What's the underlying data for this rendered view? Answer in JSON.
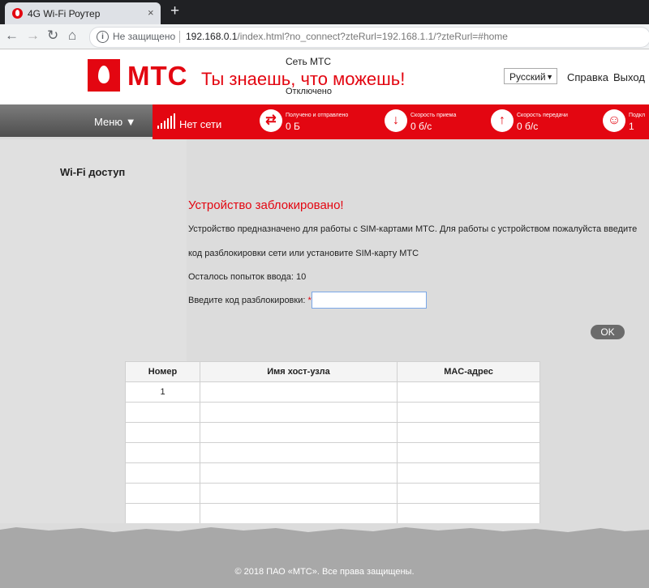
{
  "browser": {
    "tab_title": "4G Wi-Fi Роутер",
    "tab_close": "×",
    "new_tab": "+",
    "security": "Не защищено",
    "url_host": "192.168.0.1",
    "url_path": "/index.html?no_connect?zteRurl=192.168.1.1/?zteRurl=#home"
  },
  "header": {
    "brand": "МТС",
    "slogan": "Ты знаешь, что можешь!",
    "network_label": "Сеть МТС",
    "network_state": "Отключено",
    "language": "Русский",
    "help": "Справка",
    "logout": "Выход"
  },
  "status": {
    "menu": "Меню ▼",
    "signal": "Нет сети",
    "items": [
      {
        "label": "Получено и отправлено",
        "value": "0 Б",
        "icon": "swap-icon"
      },
      {
        "label": "Скорость приема",
        "value": "0 б/с",
        "icon": "download-icon"
      },
      {
        "label": "Скорость передачи",
        "value": "0 б/с",
        "icon": "upload-icon"
      },
      {
        "label": "Подкл",
        "value": "1",
        "icon": "user-icon"
      }
    ]
  },
  "main": {
    "section_title": "Wi-Fi доступ",
    "blocked_title": "Устройство заблокировано!",
    "line1": "Устройство предназначено для работы с SIM-картами МТС. Для работы с устройством пожалуйста введите",
    "line2": "код разблокировки сети или установите SIM-карту МТС",
    "attempts": "Осталось попыток ввода: 10",
    "code_label": "Введите код разблокировки:",
    "required_mark": "*",
    "code_value": "",
    "ok_label": "OK"
  },
  "table": {
    "headers": [
      "Номер",
      "Имя хост-узла",
      "MAC-адрес"
    ],
    "rows": [
      [
        "1",
        "",
        ""
      ],
      [
        "",
        "",
        ""
      ],
      [
        "",
        "",
        ""
      ],
      [
        "",
        "",
        ""
      ],
      [
        "",
        "",
        ""
      ],
      [
        "",
        "",
        ""
      ],
      [
        "",
        "",
        ""
      ],
      [
        "",
        "",
        ""
      ]
    ]
  },
  "footer": {
    "copyright": "© 2018 ПАО «МТС». Все права защищены."
  },
  "colors": {
    "brand_red": "#e30611"
  }
}
